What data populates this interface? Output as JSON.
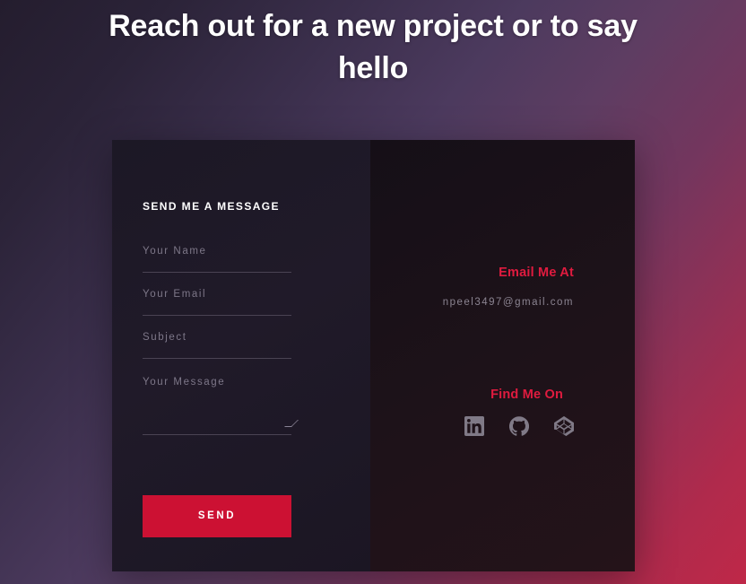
{
  "page": {
    "heading": "Reach out for a new project or to say hello",
    "background_gradient_start": "#241d2e",
    "background_gradient_end": "#bf2848",
    "accent_color": "#e01b3f",
    "button_color": "#cc1133"
  },
  "form": {
    "title": "SEND ME A MESSAGE",
    "fields": [
      {
        "name": "name",
        "placeholder": "Your Name",
        "value": ""
      },
      {
        "name": "email",
        "placeholder": "Your Email",
        "value": ""
      },
      {
        "name": "subject",
        "placeholder": "Subject",
        "value": ""
      },
      {
        "name": "message",
        "placeholder": "Your Message",
        "value": ""
      }
    ],
    "submit_label": "SEND"
  },
  "contact": {
    "email_heading": "Email Me At",
    "email_address": "npeel3497@gmail.com",
    "social_heading": "Find Me On",
    "socials": [
      {
        "icon": "linkedin-icon",
        "label": "LinkedIn"
      },
      {
        "icon": "github-icon",
        "label": "GitHub"
      },
      {
        "icon": "codepen-icon",
        "label": "CodePen"
      }
    ]
  }
}
